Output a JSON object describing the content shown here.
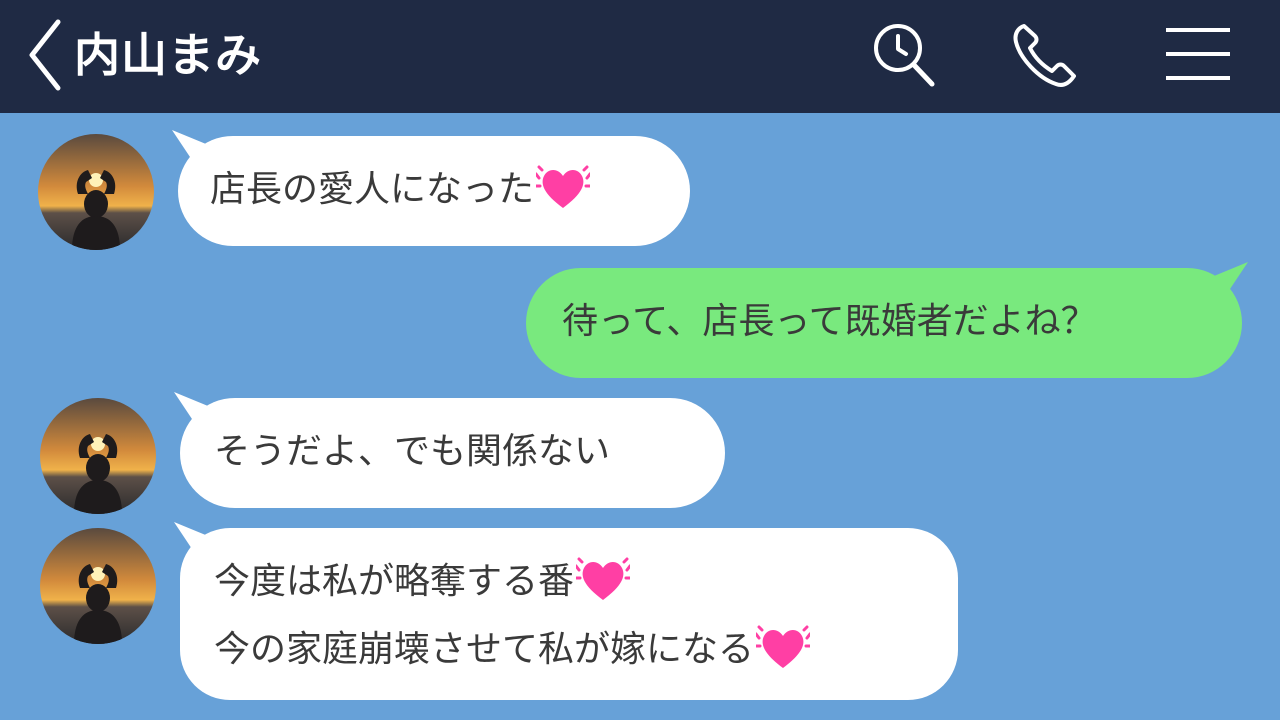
{
  "header": {
    "contact_name": "内山まみ",
    "background_color": "#1f2a44",
    "icons": [
      "back-chevron-icon",
      "search-icon",
      "phone-icon",
      "menu-icon"
    ]
  },
  "chat": {
    "background_color": "#67a1d8",
    "messages": [
      {
        "sender": "contact",
        "lines": [
          "店長の愛人になった"
        ],
        "emoji": "heart-icon",
        "bubble_color": "#ffffff"
      },
      {
        "sender": "me",
        "lines": [
          "待って、店長って既婚者だよね？"
        ],
        "bubble_color": "#79e97e"
      },
      {
        "sender": "contact",
        "lines": [
          "そうだよ、でも関係ない"
        ],
        "bubble_color": "#ffffff"
      },
      {
        "sender": "contact",
        "lines": [
          "今度は私が略奪する番",
          "今の家庭崩壊させて私が嫁になる"
        ],
        "emoji": "heart-icon",
        "bubble_color": "#ffffff"
      }
    ]
  }
}
